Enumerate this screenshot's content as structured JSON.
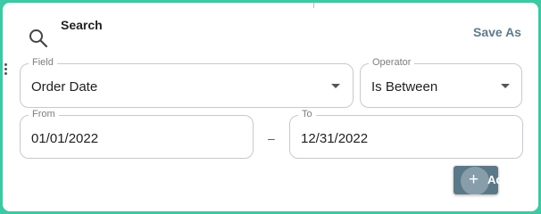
{
  "header": {
    "title": "Search",
    "save_as": "Save As"
  },
  "fields": {
    "field": {
      "label": "Field",
      "value": "Order Date"
    },
    "operator": {
      "label": "Operator",
      "value": "Is Between"
    },
    "from": {
      "label": "From",
      "value": "01/01/2022"
    },
    "to": {
      "label": "To",
      "value": "12/31/2022"
    }
  },
  "range_separator": "–",
  "add_button": {
    "label": "Add"
  },
  "icons": {
    "search": "search-icon",
    "dropdown": "chevron-down-icon",
    "add": "plus-icon"
  },
  "colors": {
    "border": "#3cc9a3",
    "accent": "#5e7b8a",
    "button": "#5b7889"
  }
}
